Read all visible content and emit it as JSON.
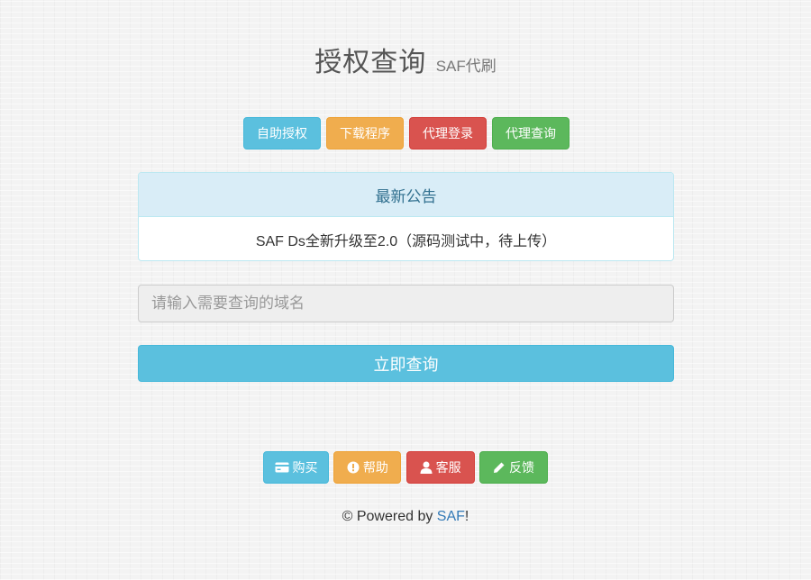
{
  "header": {
    "title": "授权查询",
    "subtitle": "SAF代刷"
  },
  "nav": {
    "buttons": [
      {
        "label": "自助授权",
        "color": "#5bc0de"
      },
      {
        "label": "下载程序",
        "color": "#f0ad4e"
      },
      {
        "label": "代理登录",
        "color": "#d9534f"
      },
      {
        "label": "代理查询",
        "color": "#5cb85c"
      }
    ]
  },
  "announcement": {
    "heading": "最新公告",
    "body": "SAF Ds全新升级至2.0（源码测试中，待上传）"
  },
  "search": {
    "placeholder": "请输入需要查询的域名",
    "value": "",
    "submit_label": "立即查询"
  },
  "footer": {
    "buttons": [
      {
        "label": "购买",
        "icon": "credit-card-icon",
        "color": "#5bc0de"
      },
      {
        "label": "帮助",
        "icon": "exclamation-circle-icon",
        "color": "#f0ad4e"
      },
      {
        "label": "客服",
        "icon": "user-icon",
        "color": "#d9534f"
      },
      {
        "label": "反馈",
        "icon": "pencil-icon",
        "color": "#5cb85c"
      }
    ],
    "powered_prefix": "© Powered by ",
    "powered_link": "SAF",
    "powered_suffix": "!"
  }
}
